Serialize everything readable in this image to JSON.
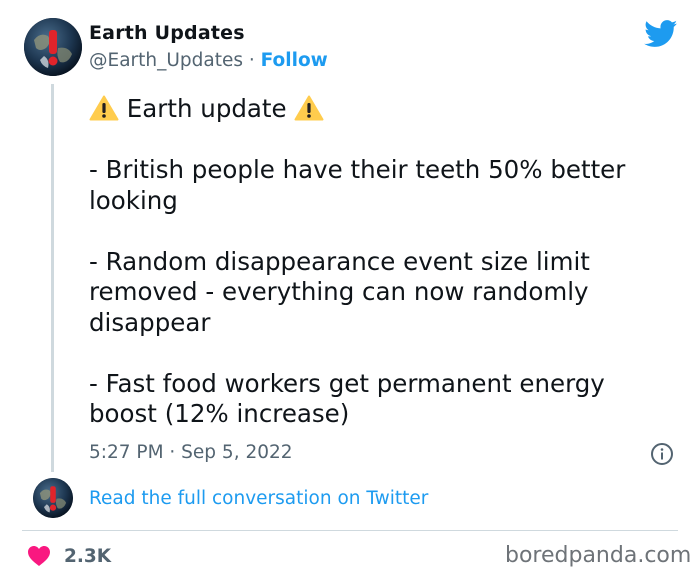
{
  "author": {
    "name": "Earth Updates",
    "handle": "@Earth_Updates",
    "separator": "·",
    "follow_label": "Follow"
  },
  "tweet": {
    "title": "Earth update",
    "items": [
      "- British people have their teeth 50% better looking",
      "- Random disappearance event size limit removed - everything can now randomly disappear",
      "- Fast food workers get permanent energy boost (12% increase)"
    ],
    "timestamp": "5:27 PM · Sep 5, 2022"
  },
  "conversation_link": "Read the full conversation on Twitter",
  "likes": "2.3K",
  "watermark": "boredpanda.com",
  "colors": {
    "accent": "#1d9bf0",
    "heart": "#f91880",
    "muted": "#536471",
    "warning": "#ffcc4d"
  },
  "icons": [
    "globe-avatar",
    "twitter-bird-icon",
    "warning-icon",
    "info-icon",
    "heart-icon"
  ]
}
